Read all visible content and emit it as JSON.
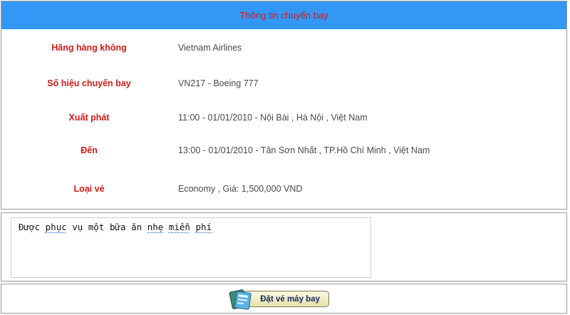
{
  "header": {
    "title": "Thông tin chuyến bay"
  },
  "flight": {
    "rows": [
      {
        "label": "Hãng hàng không",
        "value": "Vietnam Airlines"
      },
      {
        "label": "Số hiệu chuyến bay",
        "value": "VN217 - Boeing 777"
      },
      {
        "label": "Xuất phát",
        "value": "11:00 - 01/01/2010 - Nội Bài , Hà Nội , Việt Nam"
      },
      {
        "label": "Đến",
        "value": "13:00 - 01/01/2010 - Tân Sơn Nhất , TP.Hồ Chí Minh , Việt Nam"
      },
      {
        "label": "Loại vé",
        "value": "Economy , Giá: 1,500,000 VND"
      }
    ]
  },
  "notes": {
    "words": [
      "Được",
      "phục",
      "vụ",
      "một",
      "bữa",
      "ăn",
      "nhẹ",
      "miễn",
      "phí"
    ]
  },
  "actions": {
    "book_label": "Đặt vé máy bay",
    "book_icon": "ticket-icon"
  },
  "colors": {
    "header_bg": "#3397f5",
    "accent_red": "#d11a1a",
    "value_text": "#4a4a4a"
  }
}
